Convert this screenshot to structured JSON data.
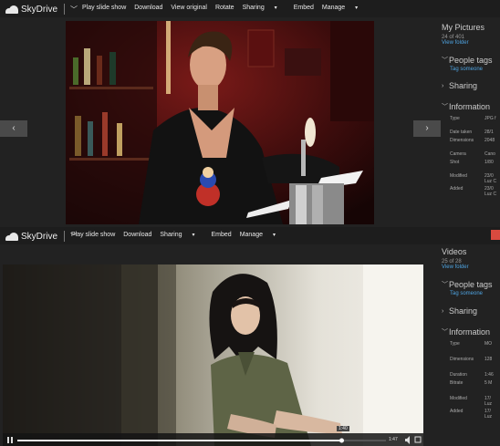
{
  "brand": {
    "name": "SkyDrive"
  },
  "photo_viewer": {
    "menu": [
      "Play slide show",
      "Download",
      "View original",
      "Rotate",
      "Sharing",
      "Embed",
      "Manage"
    ],
    "album_title": "My Pictures",
    "count": "24 of 401",
    "view_folder": "View folder",
    "people_tags": "People tags",
    "tag_someone": "Tag someone",
    "sharing": "Sharing",
    "information": "Information",
    "props": [
      {
        "k": "Type",
        "v": "JPG f"
      },
      {
        "k": "Date taken",
        "v": "28/1"
      },
      {
        "k": "Dimensions",
        "v": "2048"
      },
      {
        "k": "Camera",
        "v": "Cano"
      },
      {
        "k": "Shot",
        "v": "1/80"
      },
      {
        "k": "Modified",
        "v": "23/0"
      },
      {
        "k": "",
        "v": "Luz C"
      },
      {
        "k": "Added",
        "v": "23/0"
      },
      {
        "k": "",
        "v": "Luz C"
      }
    ]
  },
  "video_viewer": {
    "menu": [
      "Play slide show",
      "Download",
      "Sharing",
      "Embed",
      "Manage"
    ],
    "album_title": "Videos",
    "count": "25 of 28",
    "view_folder": "View folder",
    "people_tags": "People tags",
    "tag_someone": "Tag someone",
    "sharing": "Sharing",
    "information": "Information",
    "props": [
      {
        "k": "Type",
        "v": "MO"
      },
      {
        "k": "Dimensions",
        "v": "128"
      },
      {
        "k": "Duration",
        "v": "1:46"
      },
      {
        "k": "Bitrate",
        "v": "5 M"
      },
      {
        "k": "Modified",
        "v": "17/"
      },
      {
        "k": "",
        "v": "Luz"
      },
      {
        "k": "Added",
        "v": "17/"
      },
      {
        "k": "",
        "v": "Luz"
      }
    ],
    "time_elapsed": "1:40",
    "time_total": "1:47",
    "progress": 0.88
  },
  "colors": {
    "accent_link": "#4ea3e0",
    "brand_corner": "#d84a3f"
  }
}
